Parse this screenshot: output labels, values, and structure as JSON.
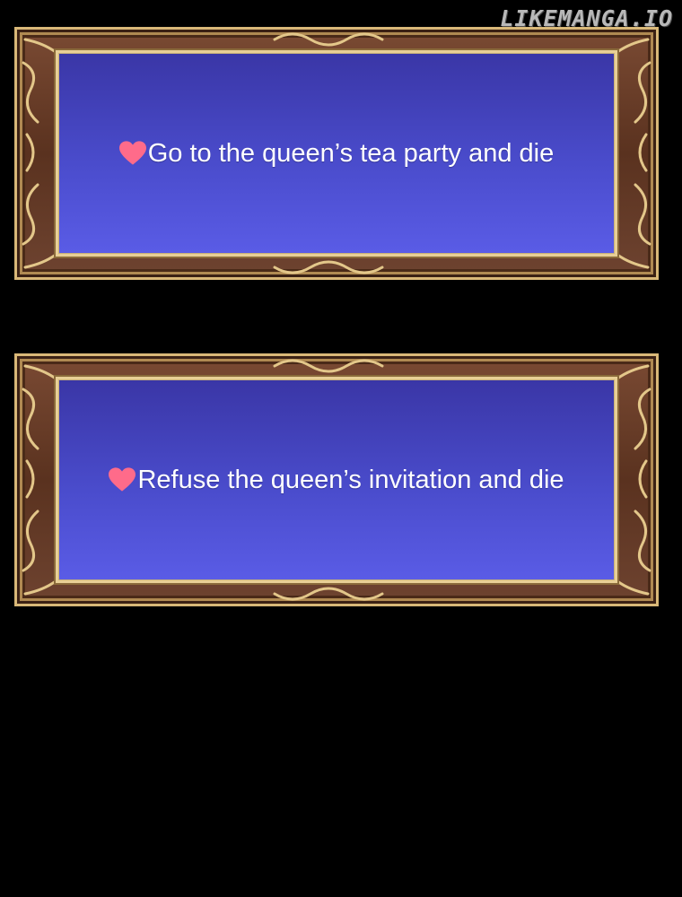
{
  "watermark": "LIKEMANGA.IO",
  "choices": [
    {
      "text": "Go to the queen’s tea party and die",
      "icon": "heart-icon"
    },
    {
      "text": "Refuse the queen’s invitation and die",
      "icon": "heart-icon"
    }
  ],
  "colors": {
    "background": "#000000",
    "panel": "#4a4ccc",
    "frame": "#6e4330",
    "gold": "#e8cf96",
    "heart": "#ff6b8a",
    "text": "#ffffff"
  }
}
